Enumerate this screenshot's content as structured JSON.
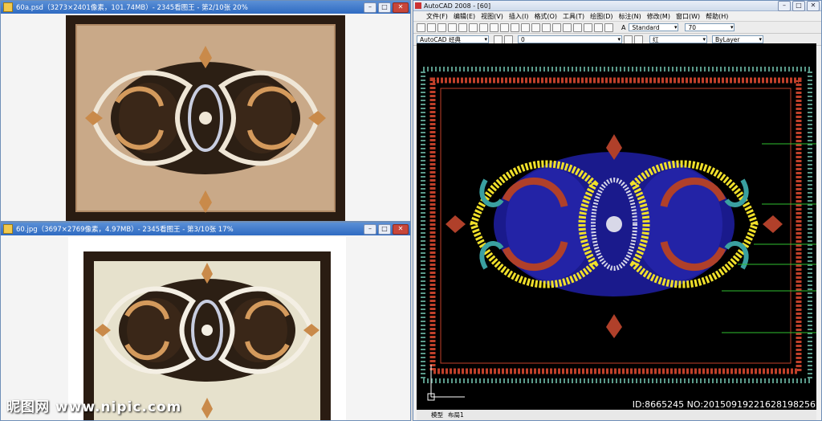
{
  "window1": {
    "title": "60a.psd（3273×2401像素，101.74MB）- 2345看图王 - 第2/10张 20%"
  },
  "window2": {
    "title": "60.jpg（3697×2769像素，4.97MB）- 2345看图王 - 第3/10张 17%"
  },
  "cad": {
    "title": "AutoCAD 2008 - [60]",
    "menu": [
      "文件(F)",
      "编辑(E)",
      "视图(V)",
      "插入(I)",
      "格式(O)",
      "工具(T)",
      "绘图(D)",
      "标注(N)",
      "修改(M)",
      "窗口(W)",
      "帮助(H)"
    ],
    "workspace": "AutoCAD 经典",
    "layer": "0",
    "text_style": "Standard",
    "text_height": "70",
    "color": "红",
    "linetype": "ByLayer",
    "tabs": [
      "模型",
      "布局1"
    ]
  },
  "watermark": {
    "left": "昵图网 www.nipic.com",
    "right": "ID:8665245 NO:20150919221628198256"
  },
  "colors": {
    "accent_blue": "#2f6bc2",
    "cad_bg": "#000000",
    "gold": "#f0e02a",
    "rust": "#b0402a",
    "navy": "#1a1a8c"
  }
}
